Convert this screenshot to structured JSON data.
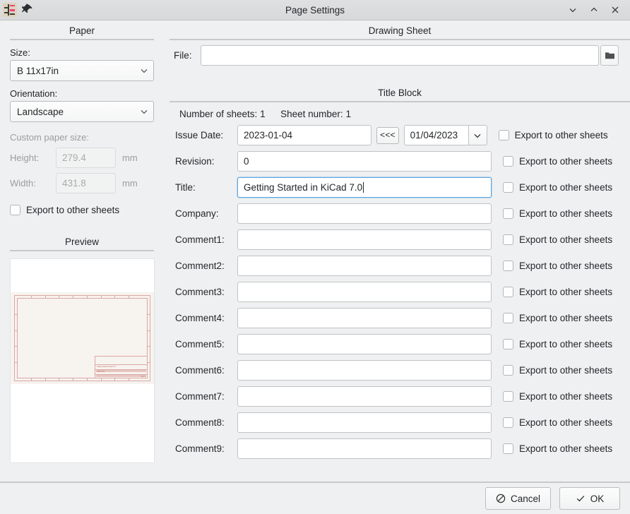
{
  "window": {
    "title": "Page Settings",
    "app_icon": "kicad-eeschema-icon",
    "pin_icon": "pin-icon",
    "minimize_icon": "chevron-down-icon",
    "maximize_icon": "chevron-up-icon",
    "close_icon": "close-icon"
  },
  "paper": {
    "heading": "Paper",
    "size_label": "Size:",
    "size_value": "B 11x17in",
    "orientation_label": "Orientation:",
    "orientation_value": "Landscape",
    "custom_label": "Custom paper size:",
    "height_label": "Height:",
    "height_value": "279.4",
    "height_unit": "mm",
    "width_label": "Width:",
    "width_value": "431.8",
    "width_unit": "mm",
    "export_label": "Export to other sheets",
    "export_checked": false
  },
  "preview": {
    "heading": "Preview",
    "sheet_bg": "#f7f3ef",
    "frame_color": "#d9a9a4",
    "titleblock_lines": [
      "Getting Started in KiCad 7.0",
      "2023-01-04",
      "Rev: 0"
    ]
  },
  "drawing_sheet": {
    "heading": "Drawing Sheet",
    "file_label": "File:",
    "file_value": "",
    "browse_icon": "folder-icon"
  },
  "title_block": {
    "heading": "Title Block",
    "number_of_sheets_label": "Number of sheets:",
    "number_of_sheets_value": "1",
    "sheet_number_label": "Sheet number:",
    "sheet_number_value": "1",
    "export_label": "Export to other sheets",
    "issue_date": {
      "label": "Issue Date:",
      "value": "2023-01-04",
      "apply_button": "<<<",
      "picker_value": "01/04/2023",
      "picker_icon": "chevron-down-icon",
      "export_checked": false
    },
    "rows": [
      {
        "label": "Revision:",
        "value": "0",
        "focused": false,
        "export_checked": false
      },
      {
        "label": "Title:",
        "value": "Getting Started in KiCad 7.0",
        "focused": true,
        "export_checked": false
      },
      {
        "label": "Company:",
        "value": "",
        "focused": false,
        "export_checked": false
      },
      {
        "label": "Comment1:",
        "value": "",
        "focused": false,
        "export_checked": false
      },
      {
        "label": "Comment2:",
        "value": "",
        "focused": false,
        "export_checked": false
      },
      {
        "label": "Comment3:",
        "value": "",
        "focused": false,
        "export_checked": false
      },
      {
        "label": "Comment4:",
        "value": "",
        "focused": false,
        "export_checked": false
      },
      {
        "label": "Comment5:",
        "value": "",
        "focused": false,
        "export_checked": false
      },
      {
        "label": "Comment6:",
        "value": "",
        "focused": false,
        "export_checked": false
      },
      {
        "label": "Comment7:",
        "value": "",
        "focused": false,
        "export_checked": false
      },
      {
        "label": "Comment8:",
        "value": "",
        "focused": false,
        "export_checked": false
      },
      {
        "label": "Comment9:",
        "value": "",
        "focused": false,
        "export_checked": false
      }
    ]
  },
  "footer": {
    "cancel_label": "Cancel",
    "cancel_icon": "no-entry-icon",
    "ok_label": "OK",
    "ok_icon": "check-icon"
  },
  "colors": {
    "background": "#eff0f1",
    "accent_focus": "#5fa8dd",
    "rule": "#c8c9ca"
  }
}
